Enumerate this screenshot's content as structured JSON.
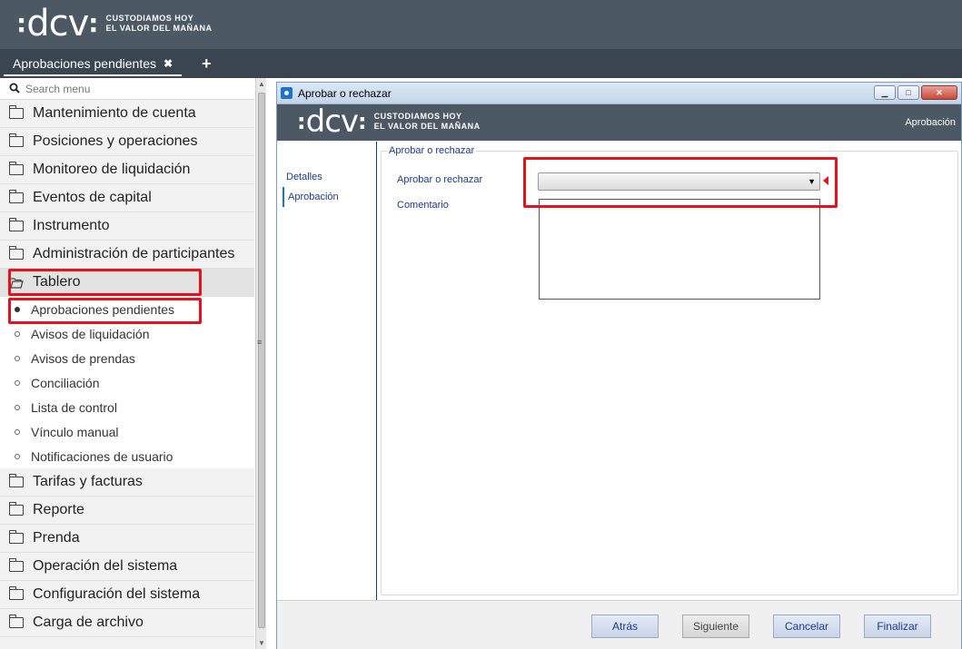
{
  "brand": {
    "dots": ":",
    "word": "dcv",
    "dots_suffix": ":",
    "tagline_1": "CUSTODIAMOS HOY",
    "tagline_2": "EL VALOR DEL MAÑANA"
  },
  "tabs": [
    {
      "label": "Aprobaciones pendientes",
      "close": "✖"
    }
  ],
  "tab_add": "+",
  "search": {
    "placeholder": "Search menu"
  },
  "menu": {
    "items_top": [
      "Mantenimiento de cuenta",
      "Posiciones y operaciones",
      "Monitoreo de liquidación",
      "Eventos de capital",
      "Instrumento",
      "Administración de participantes"
    ],
    "open_item": "Tablero",
    "sub_items": [
      "Aprobaciones pendientes",
      "Avisos de liquidación",
      "Avisos de prendas",
      "Conciliación",
      "Lista de control",
      "Vínculo manual",
      "Notificaciones de usuario"
    ],
    "items_bottom": [
      "Tarifas y facturas",
      "Reporte",
      "Prenda",
      "Operación del sistema",
      "Configuración del sistema",
      "Carga de archivo"
    ]
  },
  "dialog": {
    "title": "Aprobar o rechazar",
    "header_right": "Aprobación",
    "steps": [
      "Detalles",
      "Aprobación"
    ],
    "group_legend": "Aprobar o rechazar",
    "field_decision_label": "Aprobar o rechazar",
    "field_decision_value": "",
    "field_comment_label": "Comentario",
    "field_comment_value": "",
    "buttons": {
      "back": "Atrás",
      "next": "Siguiente",
      "cancel": "Cancelar",
      "finish": "Finalizar"
    }
  },
  "colors": {
    "header_bg": "#4c5863",
    "highlight": "#e3131b",
    "label_blue": "#1a3a8c"
  }
}
